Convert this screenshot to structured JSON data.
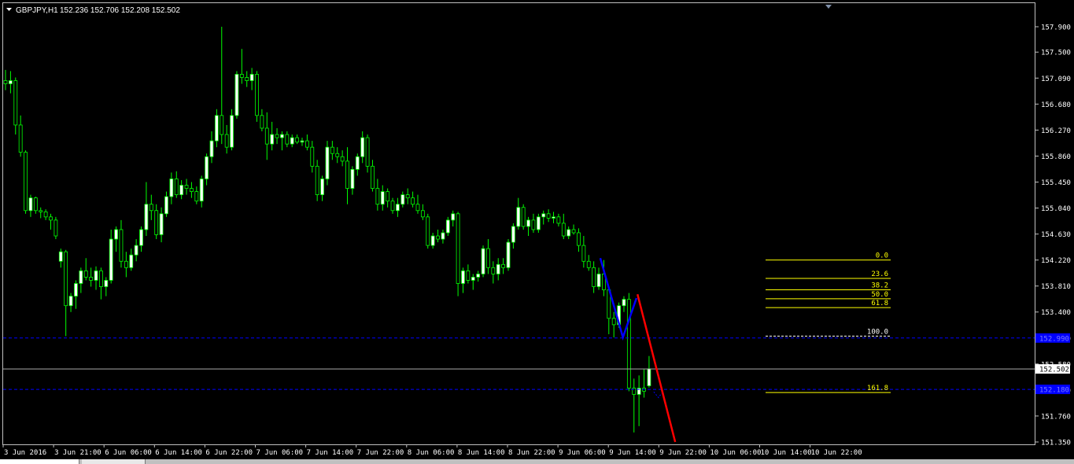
{
  "window": {
    "symbol": "GBPJPY,H1",
    "ohlc": "152.236 152.706 152.208 152.502",
    "title_icon": "dropdown-triangle-icon"
  },
  "colors": {
    "background": "#000000",
    "frame": "#c0c0c0",
    "bull": "#ffffff",
    "bear": "#000000",
    "wick": "#00ff00",
    "fib": "#ffff00",
    "blue": "#0000ff",
    "red": "#ff0000",
    "axis_text": "#ffffff"
  },
  "price_axis": {
    "labels": [
      "157.900",
      "157.500",
      "157.090",
      "156.680",
      "156.270",
      "155.860",
      "155.450",
      "155.040",
      "154.630",
      "154.220",
      "153.810",
      "153.400",
      "152.990",
      "152.580",
      "152.170",
      "151.760",
      "151.350"
    ],
    "current_price": "152.502",
    "blue_level_high": "152.990",
    "blue_level_low": "152.180"
  },
  "time_axis": {
    "labels": [
      "3 Jun 2016",
      "3 Jun 21:00",
      "6 Jun 06:00",
      "6 Jun 14:00",
      "6 Jun 22:00",
      "7 Jun 06:00",
      "7 Jun 14:00",
      "7 Jun 22:00",
      "8 Jun 06:00",
      "8 Jun 14:00",
      "8 Jun 22:00",
      "9 Jun 06:00",
      "9 Jun 14:00",
      "9 Jun 22:00",
      "10 Jun 06:00",
      "10 Jun 14:00",
      "10 Jun 22:00"
    ]
  },
  "fibonacci": {
    "levels": [
      {
        "label": "0.0",
        "price": 154.22
      },
      {
        "label": "23.6",
        "price": 153.93
      },
      {
        "label": "38.2",
        "price": 153.75
      },
      {
        "label": "50.0",
        "price": 153.61
      },
      {
        "label": "61.8",
        "price": 153.47
      },
      {
        "label": "100.0",
        "price": 153.02
      },
      {
        "label": "161.8",
        "price": 152.13
      }
    ]
  },
  "chart_data": {
    "type": "candlestick",
    "symbol": "GBPJPY",
    "timeframe": "H1",
    "ylim": [
      151.35,
      158.05
    ],
    "candles": [
      {
        "o": 157.05,
        "h": 157.22,
        "l": 156.9,
        "c": 157.0
      },
      {
        "o": 157.0,
        "h": 157.2,
        "l": 156.85,
        "c": 157.05
      },
      {
        "o": 157.05,
        "h": 157.1,
        "l": 156.2,
        "c": 156.35
      },
      {
        "o": 156.35,
        "h": 156.5,
        "l": 155.85,
        "c": 155.92
      },
      {
        "o": 155.92,
        "h": 155.95,
        "l": 154.95,
        "c": 155.0
      },
      {
        "o": 155.0,
        "h": 155.25,
        "l": 154.9,
        "c": 155.2
      },
      {
        "o": 155.2,
        "h": 155.22,
        "l": 154.95,
        "c": 155.0
      },
      {
        "o": 155.0,
        "h": 155.05,
        "l": 154.88,
        "c": 154.98
      },
      {
        "o": 154.98,
        "h": 155.02,
        "l": 154.85,
        "c": 154.9
      },
      {
        "o": 154.9,
        "h": 154.95,
        "l": 154.7,
        "c": 154.85
      },
      {
        "o": 154.85,
        "h": 154.9,
        "l": 154.55,
        "c": 154.6
      },
      {
        "o": 154.2,
        "h": 154.4,
        "l": 154.1,
        "c": 154.35
      },
      {
        "o": 154.35,
        "h": 154.38,
        "l": 153.02,
        "c": 153.5
      },
      {
        "o": 153.5,
        "h": 153.7,
        "l": 153.4,
        "c": 153.65
      },
      {
        "o": 153.65,
        "h": 153.9,
        "l": 153.45,
        "c": 153.85
      },
      {
        "o": 153.85,
        "h": 154.1,
        "l": 153.7,
        "c": 154.05
      },
      {
        "o": 154.05,
        "h": 154.25,
        "l": 153.9,
        "c": 153.95
      },
      {
        "o": 153.95,
        "h": 154.1,
        "l": 153.8,
        "c": 153.9
      },
      {
        "o": 153.9,
        "h": 154.12,
        "l": 153.75,
        "c": 154.05
      },
      {
        "o": 154.05,
        "h": 154.1,
        "l": 153.6,
        "c": 153.8
      },
      {
        "o": 153.8,
        "h": 153.95,
        "l": 153.65,
        "c": 153.9
      },
      {
        "o": 153.9,
        "h": 154.7,
        "l": 153.85,
        "c": 154.55
      },
      {
        "o": 154.55,
        "h": 154.75,
        "l": 154.35,
        "c": 154.7
      },
      {
        "o": 154.7,
        "h": 154.85,
        "l": 154.1,
        "c": 154.2
      },
      {
        "o": 154.2,
        "h": 154.35,
        "l": 153.95,
        "c": 154.1
      },
      {
        "o": 154.1,
        "h": 154.4,
        "l": 154.05,
        "c": 154.3
      },
      {
        "o": 154.3,
        "h": 154.55,
        "l": 154.2,
        "c": 154.45
      },
      {
        "o": 154.45,
        "h": 154.75,
        "l": 154.35,
        "c": 154.7
      },
      {
        "o": 154.7,
        "h": 155.45,
        "l": 154.6,
        "c": 155.1
      },
      {
        "o": 155.1,
        "h": 155.25,
        "l": 154.85,
        "c": 155.0
      },
      {
        "o": 155.0,
        "h": 155.1,
        "l": 154.55,
        "c": 154.62
      },
      {
        "o": 154.62,
        "h": 155.05,
        "l": 154.5,
        "c": 154.95
      },
      {
        "o": 154.95,
        "h": 155.3,
        "l": 154.9,
        "c": 155.22
      },
      {
        "o": 155.22,
        "h": 155.6,
        "l": 155.1,
        "c": 155.5
      },
      {
        "o": 155.5,
        "h": 155.62,
        "l": 155.2,
        "c": 155.25
      },
      {
        "o": 155.25,
        "h": 155.48,
        "l": 155.18,
        "c": 155.4
      },
      {
        "o": 155.4,
        "h": 155.5,
        "l": 155.25,
        "c": 155.35
      },
      {
        "o": 155.35,
        "h": 155.45,
        "l": 155.2,
        "c": 155.3
      },
      {
        "o": 155.3,
        "h": 155.38,
        "l": 155.1,
        "c": 155.15
      },
      {
        "o": 155.15,
        "h": 155.55,
        "l": 155.05,
        "c": 155.5
      },
      {
        "o": 155.5,
        "h": 155.9,
        "l": 155.4,
        "c": 155.85
      },
      {
        "o": 155.85,
        "h": 156.25,
        "l": 155.75,
        "c": 156.1
      },
      {
        "o": 156.1,
        "h": 156.6,
        "l": 156.0,
        "c": 156.5
      },
      {
        "o": 156.5,
        "h": 157.9,
        "l": 156.05,
        "c": 156.2
      },
      {
        "o": 156.2,
        "h": 156.35,
        "l": 155.9,
        "c": 156.0
      },
      {
        "o": 156.0,
        "h": 156.6,
        "l": 155.95,
        "c": 156.5
      },
      {
        "o": 156.5,
        "h": 157.2,
        "l": 156.45,
        "c": 157.15
      },
      {
        "o": 157.15,
        "h": 157.55,
        "l": 157.0,
        "c": 157.1
      },
      {
        "o": 157.1,
        "h": 157.2,
        "l": 156.95,
        "c": 157.05
      },
      {
        "o": 157.05,
        "h": 157.25,
        "l": 156.9,
        "c": 157.15
      },
      {
        "o": 157.15,
        "h": 157.2,
        "l": 156.4,
        "c": 156.5
      },
      {
        "o": 156.5,
        "h": 156.6,
        "l": 156.25,
        "c": 156.3
      },
      {
        "o": 156.3,
        "h": 156.55,
        "l": 155.8,
        "c": 156.05
      },
      {
        "o": 156.05,
        "h": 156.4,
        "l": 155.95,
        "c": 156.2
      },
      {
        "o": 156.2,
        "h": 156.3,
        "l": 156.05,
        "c": 156.15
      },
      {
        "o": 156.15,
        "h": 156.25,
        "l": 155.95,
        "c": 156.2
      },
      {
        "o": 156.2,
        "h": 156.25,
        "l": 156.0,
        "c": 156.05
      },
      {
        "o": 156.05,
        "h": 156.2,
        "l": 156.0,
        "c": 156.15
      },
      {
        "o": 156.15,
        "h": 156.2,
        "l": 156.05,
        "c": 156.08
      },
      {
        "o": 156.08,
        "h": 156.15,
        "l": 156.02,
        "c": 156.1
      },
      {
        "o": 156.1,
        "h": 156.2,
        "l": 155.95,
        "c": 156.0
      },
      {
        "o": 156.0,
        "h": 156.1,
        "l": 155.6,
        "c": 155.7
      },
      {
        "o": 155.7,
        "h": 155.8,
        "l": 155.15,
        "c": 155.25
      },
      {
        "o": 155.25,
        "h": 155.55,
        "l": 155.15,
        "c": 155.5
      },
      {
        "o": 155.5,
        "h": 156.1,
        "l": 155.4,
        "c": 156.0
      },
      {
        "o": 156.0,
        "h": 156.1,
        "l": 155.8,
        "c": 155.9
      },
      {
        "o": 155.9,
        "h": 156.0,
        "l": 155.75,
        "c": 155.85
      },
      {
        "o": 155.85,
        "h": 155.95,
        "l": 155.7,
        "c": 155.78
      },
      {
        "o": 155.78,
        "h": 156.0,
        "l": 155.1,
        "c": 155.35
      },
      {
        "o": 155.35,
        "h": 155.7,
        "l": 155.25,
        "c": 155.65
      },
      {
        "o": 155.65,
        "h": 155.9,
        "l": 155.55,
        "c": 155.85
      },
      {
        "o": 155.85,
        "h": 156.25,
        "l": 155.75,
        "c": 156.15
      },
      {
        "o": 156.15,
        "h": 156.2,
        "l": 155.6,
        "c": 155.7
      },
      {
        "o": 155.7,
        "h": 155.8,
        "l": 155.3,
        "c": 155.35
      },
      {
        "o": 155.35,
        "h": 155.5,
        "l": 155.0,
        "c": 155.1
      },
      {
        "o": 155.1,
        "h": 155.4,
        "l": 155.0,
        "c": 155.3
      },
      {
        "o": 155.3,
        "h": 155.35,
        "l": 155.05,
        "c": 155.15
      },
      {
        "o": 155.15,
        "h": 155.2,
        "l": 154.95,
        "c": 155.0
      },
      {
        "o": 155.0,
        "h": 155.2,
        "l": 154.9,
        "c": 155.1
      },
      {
        "o": 155.1,
        "h": 155.3,
        "l": 155.05,
        "c": 155.25
      },
      {
        "o": 155.25,
        "h": 155.35,
        "l": 155.1,
        "c": 155.2
      },
      {
        "o": 155.2,
        "h": 155.3,
        "l": 155.05,
        "c": 155.1
      },
      {
        "o": 155.1,
        "h": 155.25,
        "l": 154.95,
        "c": 155.0
      },
      {
        "o": 155.0,
        "h": 155.1,
        "l": 154.85,
        "c": 154.9
      },
      {
        "o": 154.9,
        "h": 154.95,
        "l": 154.4,
        "c": 154.45
      },
      {
        "o": 154.45,
        "h": 154.65,
        "l": 154.4,
        "c": 154.6
      },
      {
        "o": 154.6,
        "h": 154.7,
        "l": 154.5,
        "c": 154.55
      },
      {
        "o": 154.55,
        "h": 154.7,
        "l": 154.48,
        "c": 154.65
      },
      {
        "o": 154.65,
        "h": 154.9,
        "l": 154.6,
        "c": 154.85
      },
      {
        "o": 154.85,
        "h": 155.0,
        "l": 154.75,
        "c": 154.95
      },
      {
        "o": 154.95,
        "h": 154.98,
        "l": 153.65,
        "c": 153.85
      },
      {
        "o": 153.85,
        "h": 154.1,
        "l": 153.7,
        "c": 154.05
      },
      {
        "o": 154.05,
        "h": 154.15,
        "l": 153.85,
        "c": 153.9
      },
      {
        "o": 153.9,
        "h": 154.0,
        "l": 153.75,
        "c": 153.95
      },
      {
        "o": 153.95,
        "h": 154.05,
        "l": 153.88,
        "c": 154.0
      },
      {
        "o": 154.0,
        "h": 154.45,
        "l": 153.95,
        "c": 154.4
      },
      {
        "o": 154.4,
        "h": 154.55,
        "l": 154.0,
        "c": 154.1
      },
      {
        "o": 154.1,
        "h": 154.2,
        "l": 153.85,
        "c": 154.0
      },
      {
        "o": 154.0,
        "h": 154.25,
        "l": 153.9,
        "c": 154.15
      },
      {
        "o": 154.15,
        "h": 154.25,
        "l": 154.0,
        "c": 154.1
      },
      {
        "o": 154.1,
        "h": 154.55,
        "l": 154.05,
        "c": 154.5
      },
      {
        "o": 154.5,
        "h": 154.8,
        "l": 154.4,
        "c": 154.75
      },
      {
        "o": 154.75,
        "h": 155.2,
        "l": 154.7,
        "c": 155.05
      },
      {
        "o": 155.05,
        "h": 155.1,
        "l": 154.7,
        "c": 154.75
      },
      {
        "o": 154.75,
        "h": 154.9,
        "l": 154.6,
        "c": 154.85
      },
      {
        "o": 154.85,
        "h": 154.95,
        "l": 154.65,
        "c": 154.7
      },
      {
        "o": 154.7,
        "h": 154.95,
        "l": 154.65,
        "c": 154.9
      },
      {
        "o": 154.9,
        "h": 155.0,
        "l": 154.78,
        "c": 154.95
      },
      {
        "o": 154.95,
        "h": 155.02,
        "l": 154.82,
        "c": 154.88
      },
      {
        "o": 154.88,
        "h": 154.98,
        "l": 154.8,
        "c": 154.9
      },
      {
        "o": 154.9,
        "h": 154.95,
        "l": 154.75,
        "c": 154.8
      },
      {
        "o": 154.8,
        "h": 154.95,
        "l": 154.55,
        "c": 154.6
      },
      {
        "o": 154.6,
        "h": 154.75,
        "l": 154.55,
        "c": 154.7
      },
      {
        "o": 154.7,
        "h": 154.78,
        "l": 154.62,
        "c": 154.65
      },
      {
        "o": 154.65,
        "h": 154.72,
        "l": 154.35,
        "c": 154.45
      },
      {
        "o": 154.45,
        "h": 154.6,
        "l": 154.1,
        "c": 154.2
      },
      {
        "o": 154.2,
        "h": 154.3,
        "l": 154.05,
        "c": 154.1
      },
      {
        "o": 154.1,
        "h": 154.2,
        "l": 153.7,
        "c": 153.8
      },
      {
        "o": 153.8,
        "h": 154.1,
        "l": 153.75,
        "c": 154.0
      },
      {
        "o": 154.0,
        "h": 154.22,
        "l": 153.65,
        "c": 153.75
      },
      {
        "o": 153.75,
        "h": 153.8,
        "l": 153.05,
        "c": 153.3
      },
      {
        "o": 153.3,
        "h": 153.4,
        "l": 153.0,
        "c": 153.2
      },
      {
        "o": 153.2,
        "h": 153.55,
        "l": 153.15,
        "c": 153.5
      },
      {
        "o": 153.5,
        "h": 153.65,
        "l": 153.4,
        "c": 153.6
      },
      {
        "o": 153.6,
        "h": 153.7,
        "l": 152.15,
        "c": 152.2
      },
      {
        "o": 152.2,
        "h": 152.35,
        "l": 151.5,
        "c": 152.1
      },
      {
        "o": 152.1,
        "h": 152.4,
        "l": 151.6,
        "c": 152.2
      },
      {
        "o": 152.2,
        "h": 152.5,
        "l": 152.05,
        "c": 152.15
      },
      {
        "o": 152.236,
        "h": 152.706,
        "l": 152.208,
        "c": 152.502
      }
    ]
  }
}
